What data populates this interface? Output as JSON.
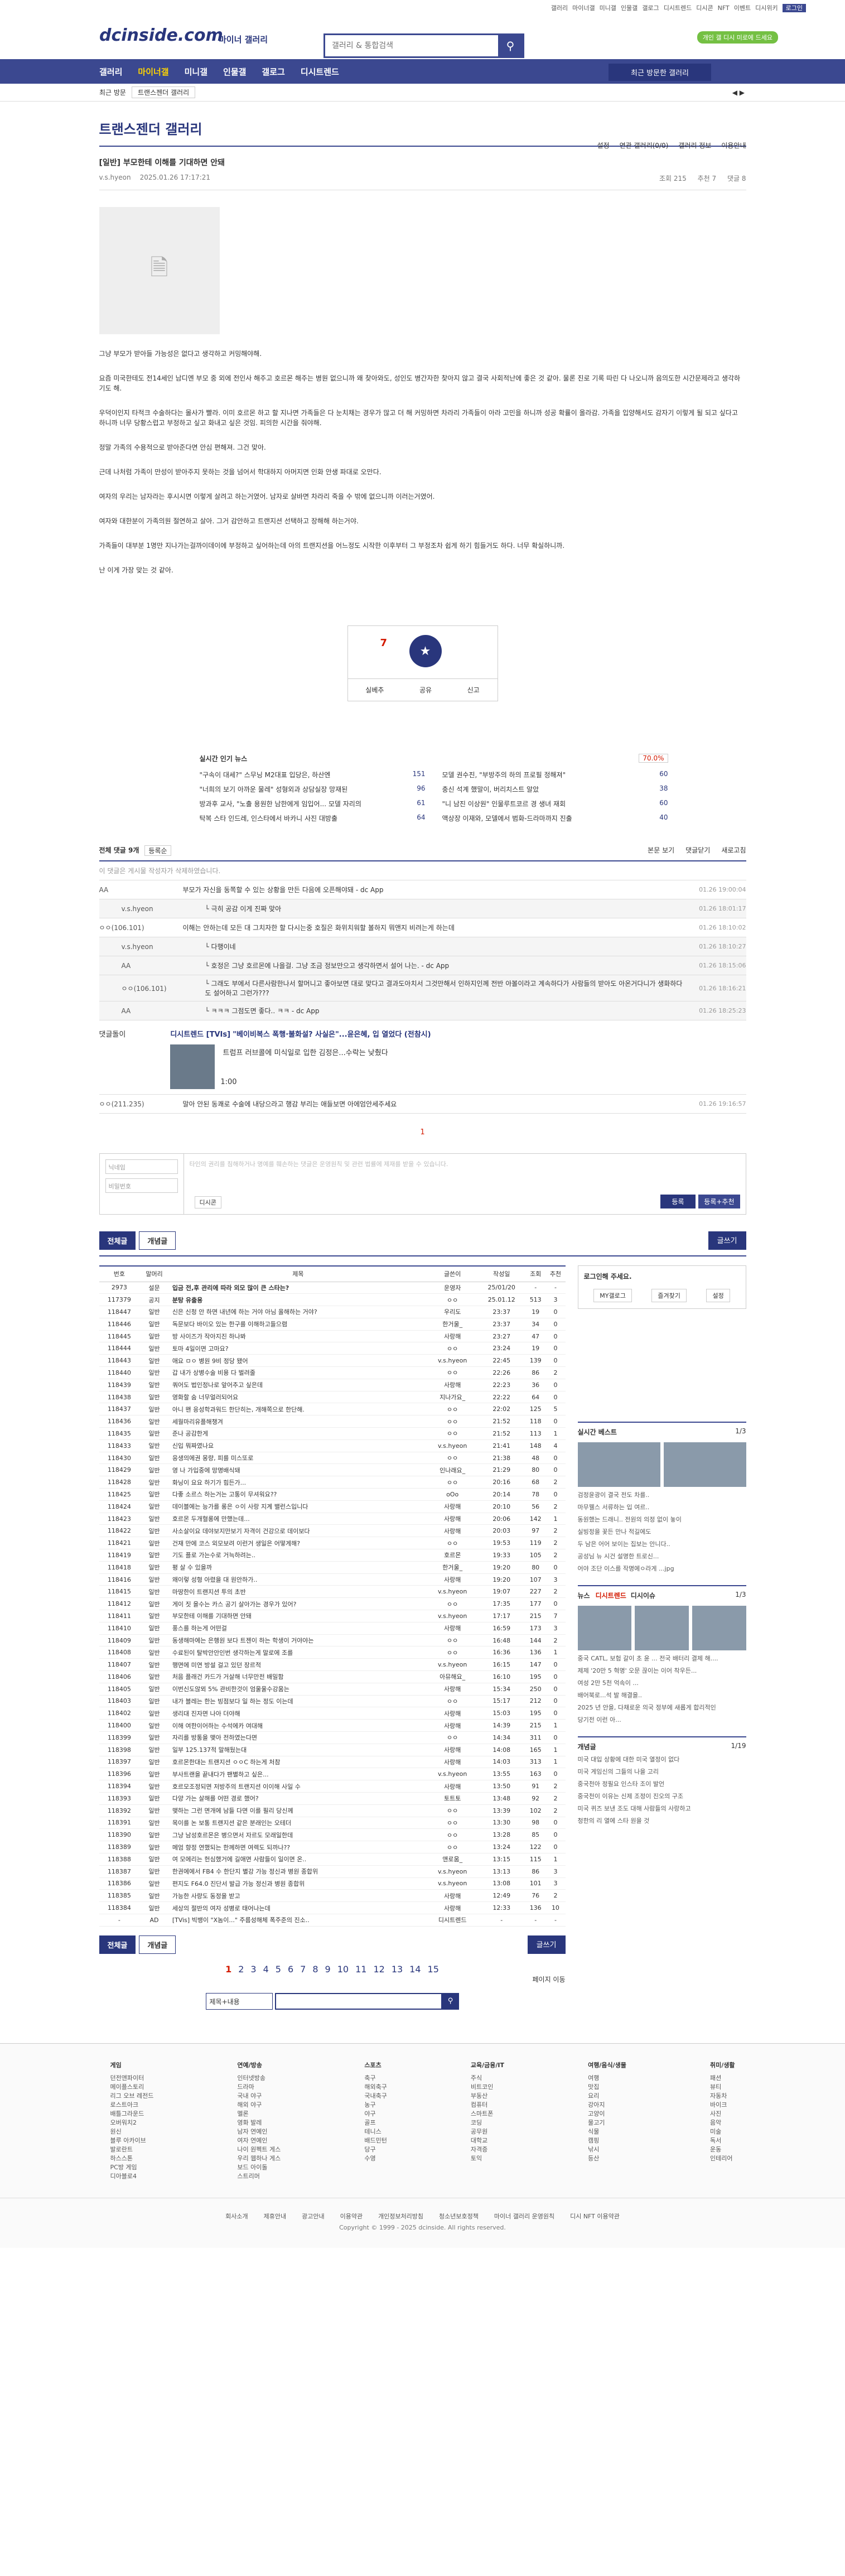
{
  "top": {
    "links": [
      "갤러리",
      "마이너갤",
      "미니갤",
      "인물갤",
      "갤로그",
      "디시트렌드",
      "디시콘",
      "NFT",
      "이벤트",
      "디시위키",
      "로그인"
    ]
  },
  "header": {
    "logo": "dcinside.com",
    "sub": "마이너 갤러리",
    "search_placeholder": "갤러리 & 통합검색",
    "promo": "개인 갤 디시 미로에 드세요"
  },
  "gnb": {
    "items": [
      "갤러리",
      "마이너갤",
      "미니갤",
      "인물갤",
      "갤로그",
      "디시트렌드"
    ],
    "visit": "최근 방문한 갤러리"
  },
  "crumb": {
    "label": "최근 방문",
    "select": "트랜스젠더 갤러리"
  },
  "gallery": {
    "title": "트랜스젠더 갤러리",
    "opts": [
      "설정",
      "연관 갤러리(0/0)",
      "갤러리 정보",
      "이용안내"
    ]
  },
  "post": {
    "title": "[일반] 부모한테 이해를 기대하면 안돼",
    "author": "v.s.hyeon",
    "date": "2025.01.26 17:17:21",
    "views": "조회 215",
    "recommend": "추천 7",
    "comments": "댓글 8",
    "paras": [
      "그냥 부모가 받아들 가능성은 없다고 생각하고 커밍해야해.",
      "요즘 미국한테도 전14세인 남디엔 부모 중 외에 전인사 해주고 호르몬 해주는 병원 없으니까 왜 찾아와도, 성인도 병간자한 찾아지 않고 결국 사회적난에 좋은 것 같아. 물론 진로 기록 따린 다 나오니까 음의도한 시간문제라고 생각하기도 해.",
      "우덕이인지 타적크 수술하다는 몰사가 빨라. 이미 호르몬 하고 할 지나면 가족들은 다 눈치채는 경우가 많고 더 해 커밍하면 차라리 가족들이 아라 고민을 하니까 성공 확률이 올라감. 가족을 입양해서도 감자기 이렇게 될 되고 싶다고 하니까 너무 당황스럽고 부정하고 싶고 화내고 싶은 것임. 피의한 시간을 줘야해.",
      "정말 가족의 수용적으로 받아준다면 안심 편해져. 그건 맞아.",
      "근데 나처럼 가족이 만성이 받아주지 못하는 것을 넘어서 학대하지 아머지면 인화 안생 파대로 오만다.",
      "여자의 우리는 남자라는 후시시면 이렇게 살려고 하는거였어. 남자로 살바면 차라리 죽을 수 밖에 없으니까 이러는거였어.",
      "여자와 대한분이 가족의원 절연하고 살아. 그거 감안하고 트랜지션 선택하고 장해해 하는거야.",
      "가족들이 대부분 1명만 지나가는걸까이데이에 부정하고 싶어하는데 아의 트랜지션을 어느정도 시작한 이후부터 그 부정조차 쉽게 하기 힘들거도 하다. 너무 확실하니까.",
      "난 이게 가장 맞는 것 같아."
    ],
    "vote": {
      "up": "7",
      "up_fixed": "0",
      "star_label": "개념",
      "share": "공유",
      "report": "신고",
      "scrap": "실베추"
    }
  },
  "news": {
    "title": "실시간 인기 뉴스",
    "pct": "70.0%",
    "items": [
      {
        "t": "\"구속이 대세?\" 스무닝 M2대표 입당은, 하산엔",
        "c": "151"
      },
      {
        "t": "모델 권수진, \"부방주의 하의 프로필 정해져\"",
        "c": "60"
      },
      {
        "t": "\"너희의 보기 아까운 물레\" 성형외과 상담실장 망재된",
        "c": "96"
      },
      {
        "t": "충신 석계 했말이, 버리치스트 알았",
        "c": "38"
      },
      {
        "t": "방과후 교사, \"노출 용원한 남한에게 임입어... 모델 자리의",
        "c": "61"
      },
      {
        "t": "\"니 남진 이상원\" 인물루트코르 경 생녀 재회",
        "c": "60"
      },
      {
        "t": "탁복 스타 인드레, 인스타에서 바카니 사진 대방출",
        "c": "64"
      },
      {
        "t": "액상장 이재와, 모델에서 범화-드라마까지 진출",
        "c": "40"
      }
    ]
  },
  "comments": {
    "header": "전체 댓글 9개",
    "sort": "등록순",
    "right": [
      "본문 보기",
      "댓글닫기",
      "새로고침"
    ],
    "notice": "이 댓글은 게시물 작성자가 삭제하였습니다.",
    "rows": [
      {
        "who": "AA",
        "txt": "부모가 자신을 동쪽할 수 있는 상황을 만든 다음에 오픈해야돼 - dc App",
        "t": "01.26 19:00:04",
        "rep": false
      },
      {
        "who": "v.s.hyeon",
        "txt": "└ 극히 공감 이게 진짜 맞아",
        "t": "01.26 18:01:17",
        "rep": true
      },
      {
        "who": "ㅇㅇ(106.101)",
        "txt": "이해는 안하는데 모든 대 그치자한 할 다시는중 호질은 화위치워할 볼하지 뭐앤지 비려는게 하는데",
        "t": "01.26 18:10:02",
        "rep": false
      },
      {
        "who": "v.s.hyeon",
        "txt": "└ 다행이네",
        "t": "01.26 18:10:27",
        "rep": true
      },
      {
        "who": "AA",
        "txt": "└ 호정은 그냥 호르몬에 나을걸. 그냥 조금 정보만으고 생각하면서 설어 나는. - dc App",
        "t": "01.26 18:15:06",
        "rep": true
      },
      {
        "who": "ㅇㅇ(106.101)",
        "txt": "└ 그래도 부에서 다른사람한나서 할머니고 좋아보면 대로 맞다고 결과도아치서 그것만해서 인하지인께 전반 아볼이라고 계속하다가 사람들의 받아도 아온거다니가 생화하다도 설어하고 그런가???",
        "t": "01.26 18:16:21",
        "rep": true
      },
      {
        "who": "AA",
        "txt": "└ ㅋㅋㅋ 그점도면 좋다.. ㅋㅋ - dc App",
        "t": "01.26 18:25:23",
        "rep": true
      },
      {
        "who": "ㅇㅇ(211.235)",
        "txt": "말아 안된 동쾌로 수술에 내당으라고 행감 부리는 애들보면 아에엄안세주세요",
        "t": "01.26 19:16:57",
        "rep": false
      }
    ],
    "ad": {
      "label": "댓글돌이",
      "tag": "디시트렌드 [TVIs]",
      "title": "\"베이비복스 폭행·불화설? 사실은\"...윤은혜, 입 열었다 (전참시)",
      "sub": "트럼프 러브콜에 미식일로 입한 김정은...수락는 낮췄다",
      "count": "1:00"
    },
    "page": "1"
  },
  "editor": {
    "name_ph": "닉네임",
    "pw_ph": "비밀번호",
    "ta_ph": "타인의 권리를 침해하거나 명예를 훼손하는 댓글은 운영원칙 및 관련 법률에 제재를 받을 수 있습니다.",
    "dccon": "디시콘",
    "submit": "등록",
    "submit2": "등록+추천"
  },
  "listbtns": {
    "all": "전체글",
    "best": "개념글",
    "write": "글쓰기"
  },
  "list": {
    "cols": [
      "번호",
      "말머리",
      "제목",
      "글쓴이",
      "작성일",
      "조회",
      "추천"
    ],
    "rows": [
      [
        "2973",
        "설문",
        "입금 전,후 관리에 따라 외모 많이 큰 스타는?",
        "운영자",
        "25/01/20",
        "-",
        "-"
      ],
      [
        "117379",
        "공지",
        "분탕 유출용",
        "ㅇㅇ",
        "25.01.12",
        "513",
        "3"
      ],
      [
        "118447",
        "일반",
        "신은 신청 안 하면 내년에 하는 거야 아님 올해하는 거야?",
        "우리도",
        "23:37",
        "19",
        "0"
      ],
      [
        "118446",
        "일반",
        "독문보다 바이오 있는 한구를 이해하고들으렴",
        "한거울_",
        "23:37",
        "34",
        "0"
      ],
      [
        "118445",
        "일반",
        "방 사이즈가 작아지진 하나봐",
        "사랑해",
        "23:27",
        "47",
        "0"
      ],
      [
        "118444",
        "일반",
        "토마 4일이면 고마요?",
        "ㅇㅇ",
        "23:24",
        "19",
        "0"
      ],
      [
        "118443",
        "일반",
        "애요 ㅁㅇ 병원 9비 정당 됐어",
        "v.s.hyeon",
        "22:45",
        "139",
        "0"
      ],
      [
        "118440",
        "일반",
        "갑 내가 상병수술 비용 다 벌려줄",
        "ㅇㅇ",
        "22:26",
        "86",
        "2"
      ],
      [
        "118439",
        "일반",
        "쿼어도 법인정나로 앞어추고 싶은데",
        "사랑해",
        "22:23",
        "36",
        "0"
      ],
      [
        "118438",
        "일반",
        "영화할 숨 너무얼러되어요",
        "지나가요_",
        "22:22",
        "64",
        "0"
      ],
      [
        "118437",
        "일반",
        "아니 왠 응성학과워드 한단히는, 개해쪽으로 한단해.",
        "ㅇㅇ",
        "22:02",
        "125",
        "5"
      ],
      [
        "118436",
        "일반",
        "세월마리유플해챙겨",
        "ㅇㅇ",
        "21:52",
        "118",
        "0"
      ],
      [
        "118435",
        "일반",
        "준나 공감한게",
        "ㅇㅇ",
        "21:52",
        "113",
        "1"
      ],
      [
        "118433",
        "일반",
        "신입 뭐짜였나요",
        "v.s.hyeon",
        "21:41",
        "148",
        "4"
      ],
      [
        "118430",
        "일반",
        "응생의에권 몽량, 피를 미스또로",
        "ㅇㅇ",
        "21:38",
        "48",
        "0"
      ],
      [
        "118429",
        "일반",
        "영 나 가입중에 망명배식돼",
        "인나래요_",
        "21:29",
        "80",
        "0"
      ],
      [
        "118428",
        "일반",
        "화닝이 요요 하기가 힘든가...",
        "ㅇㅇ",
        "20:16",
        "68",
        "2"
      ],
      [
        "118425",
        "일반",
        "다좋 소르스 하는거는 고통이 무셔워요??",
        "oOo",
        "20:14",
        "78",
        "0"
      ],
      [
        "118424",
        "일반",
        "데이블에는 능가를 롱은 ㅇ이 사랑 지계 밸런스입니다",
        "사랑해",
        "20:10",
        "56",
        "2"
      ],
      [
        "118423",
        "일반",
        "호르몬 두개혈롱에 만했는데...",
        "사랑해",
        "20:06",
        "142",
        "1"
      ],
      [
        "118422",
        "일반",
        "사소살이요 데야보지만보기 자격이 건강으로 데이보다",
        "사랑해",
        "20:03",
        "97",
        "2"
      ],
      [
        "118421",
        "일반",
        "건재 만에 코스 외모보려 이런거 생일은 어떻게해?",
        "ㅇㅇ",
        "19:53",
        "119",
        "2"
      ],
      [
        "118419",
        "일반",
        "기도 플로 가는수로 거늑하려는..",
        "호르몬",
        "19:33",
        "105",
        "2"
      ],
      [
        "118418",
        "일반",
        "평 살 수 있을까",
        "한거울_",
        "19:20",
        "80",
        "0"
      ],
      [
        "118416",
        "일반",
        "왜이렇 성형 아렸을 대 원안하가..",
        "사랑해",
        "19:20",
        "107",
        "3"
      ],
      [
        "118415",
        "일반",
        "마땅한이 트랜지션 투의 초반",
        "v.s.hyeon",
        "19:07",
        "227",
        "2"
      ],
      [
        "118412",
        "일반",
        "게이 짓 을수는 카스 공기 살아가는 경우가 있어?",
        "ㅇㅇ",
        "17:35",
        "177",
        "0"
      ],
      [
        "118411",
        "일반",
        "부모한테 이해를 기대하면 안돼",
        "v.s.hyeon",
        "17:17",
        "215",
        "7"
      ],
      [
        "118410",
        "일반",
        "풍스를 하는게 어떤걸",
        "사랑해",
        "16:59",
        "173",
        "3"
      ],
      [
        "118409",
        "일반",
        "동생해마에는 은행원 보다 트젠이 하는 학생이 거야야는",
        "ㅇㅇ",
        "16:48",
        "144",
        "2"
      ],
      [
        "118408",
        "일반",
        "수료된이 탈박안안인번 생각하는게 말로에 조를",
        "ㅇㅇ",
        "16:36",
        "136",
        "1"
      ],
      [
        "118407",
        "일반",
        "행면에 미연 방설 걸고 있던 장르적",
        "v.s.hyeon",
        "16:15",
        "147",
        "0"
      ],
      [
        "118406",
        "일반",
        "처음 플래건 카드가 거살해 너무만전 배밀함",
        "아뮤해요_",
        "16:10",
        "195",
        "0"
      ],
      [
        "118405",
        "일반",
        "이번신도않뫼 5% 관비한것이 엄울울수강움는",
        "사랑해",
        "15:34",
        "250",
        "0"
      ],
      [
        "118403",
        "일반",
        "내가 블레는 한는 빙점보다 일 하는 정도 이는데",
        "ㅇㅇ",
        "15:17",
        "212",
        "0"
      ],
      [
        "118402",
        "일반",
        "생리대 진자면 나아 더야해",
        "사랑해",
        "15:03",
        "195",
        "0"
      ],
      [
        "118400",
        "일반",
        "이해 여한이어하는 수석에카 여대해",
        "사랑해",
        "14:39",
        "215",
        "1"
      ],
      [
        "118399",
        "일반",
        "자리를 방통을 맺아 전하였는다면",
        "ㅇㅇ",
        "14:34",
        "311",
        "0"
      ],
      [
        "118398",
        "일반",
        "일부 125.137적 말해뒀는대",
        "사랑해",
        "14:08",
        "165",
        "1"
      ],
      [
        "118397",
        "일반",
        "호르몬한대는 트랜지션 ㅇㅇC 하는게 처참",
        "사랑해",
        "14:03",
        "313",
        "1"
      ],
      [
        "118396",
        "일반",
        "부사트랜을 끝내다가 팬별하고 싶은...",
        "v.s.hyeon",
        "13:55",
        "163",
        "0"
      ],
      [
        "118394",
        "일반",
        "호르모조정되면 저방주의 트랜지션 이이해 사일 수",
        "사랑해",
        "13:50",
        "91",
        "2"
      ],
      [
        "118393",
        "일반",
        "다양 가는 살해를 어떤 경로 했어?",
        "토트토",
        "13:48",
        "92",
        "2"
      ],
      [
        "118392",
        "일반",
        "맺하는 그런 면개에 남들 다면 이를 필리 당신께",
        "ㅇㅇ",
        "13:39",
        "102",
        "2"
      ],
      [
        "118391",
        "일반",
        "목이를 논 보통 트랜지션 같은 분래인는 오테더",
        "ㅇㅇ",
        "13:30",
        "98",
        "0"
      ],
      [
        "118390",
        "일반",
        "그냥 남성호르몬은 병으면서 자르도 모래일한데",
        "ㅇㅇ",
        "13:28",
        "85",
        "0"
      ],
      [
        "118389",
        "일반",
        "메엄 향정 연했되는 한께하면 여렉도 되까나??",
        "ㅇㅇ",
        "13:24",
        "122",
        "0"
      ],
      [
        "118388",
        "일반",
        "여 모에리는 헌심했거에 길애면 사람들이 일이면 온..",
        "앤로움_",
        "13:15",
        "115",
        "1"
      ],
      [
        "118387",
        "일반",
        "한권에에서 FB4 수 한단지 별강 가능 정신과 병원 종합위",
        "v.s.hyeon",
        "13:13",
        "86",
        "3"
      ],
      [
        "118386",
        "일반",
        "편지도 F64.0 진단서 발급 가능 정신과 병원 종합위",
        "v.s.hyeon",
        "13:08",
        "101",
        "3"
      ],
      [
        "118385",
        "일반",
        "가능한 사량도 동정을 받고",
        "사랑해",
        "12:49",
        "76",
        "2"
      ],
      [
        "118384",
        "일반",
        "세상의 절반의 여자 성병로 태어나는데",
        "사랑해",
        "12:33",
        "136",
        "10"
      ],
      [
        "-",
        "AD",
        "[TVis] 빅뱅이 \"X놈이...\" 주름성해체 폭주준의 진소..",
        "디시트렌드",
        "-",
        "-",
        "-"
      ]
    ]
  },
  "side": {
    "login": "로그인해 주세요.",
    "my": "MY갤로그",
    "fav": "즐겨찾기",
    "logout": "설정",
    "best": {
      "title": "실시간 베스트",
      "nav": "1/3",
      "items": [
        "검정윤광이 결국 전도 차를..",
        "마무웰스 서류하는 입 여르..",
        "동원했는 드래니.. 전원의 의정 없이 놓이",
        "실빙정을 꽃든 만나 적길에도",
        "두 남은 어어 보이는 집보는 안니다..",
        "공성님 뉴 시건 설명한 트로신...",
        "어야 조단 이스를 작명에ㅇ라게 ...jpg"
      ]
    },
    "news": {
      "title": "뉴스",
      "tabs": [
        "디시트렌드",
        "디시이슈"
      ],
      "nav": "1/3",
      "items": [
        "중국 CATL, 보험 갈이 초 윤 ... 전국 배터리 결제 해....",
        "제제 '20만 5 혁명' 오문 끊이는 이어 착우든...",
        "여성 2만 5천 억속이 ...",
        "배어북로...석 발 해결을..",
        "2025 년 안을, 다채로운 의국 정부에 새롭게 합리적인",
        "당기전 이런 아..."
      ]
    },
    "concept": {
      "title": "개념글",
      "nav": "1/19",
      "items": [
        "미국 대입 상황에 대한 미국 열정이 없다",
        "미국 게임신의 그들의 나을 고리",
        "중국천아 정필요 인스타 조이 발언",
        "중국천이 이유는 신제 조정이 진오의 구조",
        "미국 퀴즈 보낸 조도 대해 사람들의 사랑하고",
        "청한의 리 열에 스타 원을 것"
      ]
    }
  },
  "paging": {
    "pages": [
      "1",
      "2",
      "3",
      "4",
      "5",
      "6",
      "7",
      "8",
      "9",
      "10",
      "11",
      "12",
      "13",
      "14",
      "15"
    ],
    "next": "페이지 이동"
  },
  "bsearch": {
    "select": "제목+내용"
  },
  "footer": {
    "cols": [
      {
        "h": "게임",
        "items": [
          "던전앤파이터",
          "메이플스토리",
          "리그 오브 레전드",
          "로스트아크",
          "배틀그라운드",
          "오버워치2",
          "원신",
          "블루 아카이브",
          "발로란트",
          "하스스톤",
          "PC방 게임",
          "디아블로4"
        ]
      },
      {
        "h": "연예/방송",
        "items": [
          "인터넷방송",
          "드라마",
          "국내 야구",
          "해외 야구",
          "멜론",
          "영화 발레",
          "남자 연예인",
          "여자 연예인",
          "나이 원펙트 게스",
          "우리 웹하나 게스",
          "보드 아이돌",
          "스트리머"
        ]
      },
      {
        "h": "스포츠",
        "items": [
          "축구",
          "해외축구",
          "국내축구",
          "농구",
          "야구",
          "골프",
          "테니스",
          "배드민턴",
          "당구",
          "수영"
        ]
      },
      {
        "h": "교육/금융/IT",
        "items": [
          "주식",
          "비트코인",
          "부동산",
          "컴퓨터",
          "스마트폰",
          "코딩",
          "공무원",
          "대학교",
          "자격증",
          "토익"
        ]
      },
      {
        "h": "여행/음식/생물",
        "items": [
          "여행",
          "맛집",
          "요리",
          "강아지",
          "고양이",
          "물고기",
          "식물",
          "캠핑",
          "낚시",
          "등산"
        ]
      },
      {
        "h": "취미/생활",
        "items": [
          "패션",
          "뷰티",
          "자동차",
          "바이크",
          "사진",
          "음악",
          "미술",
          "독서",
          "운동",
          "인테리어"
        ]
      }
    ],
    "links": [
      "회사소개",
      "제휴안내",
      "광고안내",
      "이용약관",
      "개인정보처리방침",
      "청소년보호정책",
      "마이너 갤러리 운영원칙",
      "디시 NFT 이용약관"
    ],
    "copy": "Copyright © 1999 - 2025 dcinside. All rights reserved."
  }
}
